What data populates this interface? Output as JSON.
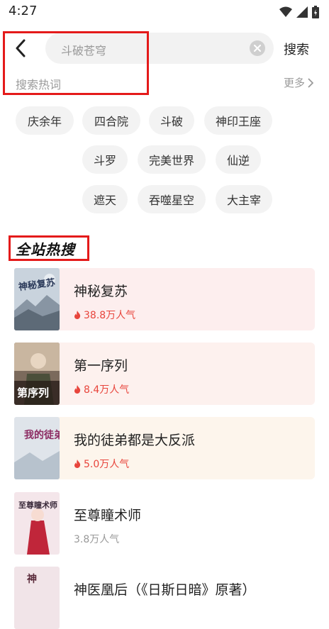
{
  "status_bar": {
    "time": "4:27"
  },
  "search": {
    "query": "斗破苍穹",
    "button_label": "搜索"
  },
  "hot_words": {
    "title": "搜索热词",
    "more_label": "更多",
    "tags": [
      "庆余年",
      "四合院",
      "斗破",
      "神印王座",
      "斗罗",
      "完美世界",
      "仙逆",
      "遮天",
      "吞噬星空",
      "大主宰"
    ]
  },
  "ranking": {
    "title": "全站热搜",
    "items": [
      {
        "title": "神秘复苏",
        "popularity": "38.8万人气",
        "cover_text": "神秘复苏"
      },
      {
        "title": "第一序列",
        "popularity": "8.4万人气",
        "cover_text": "第序列"
      },
      {
        "title": "我的徒弟都是大反派",
        "popularity": "5.0万人气",
        "cover_text": "我的徒弟"
      },
      {
        "title": "至尊瞳术师",
        "popularity": "3.8万人气",
        "cover_text": "至尊瞳术师"
      },
      {
        "title": "神医凰后（《日斯日暗》原著）",
        "popularity": "",
        "cover_text": "神"
      }
    ]
  },
  "colors": {
    "accent_red": "#e8453c",
    "highlight_red": "#e41a1a"
  }
}
